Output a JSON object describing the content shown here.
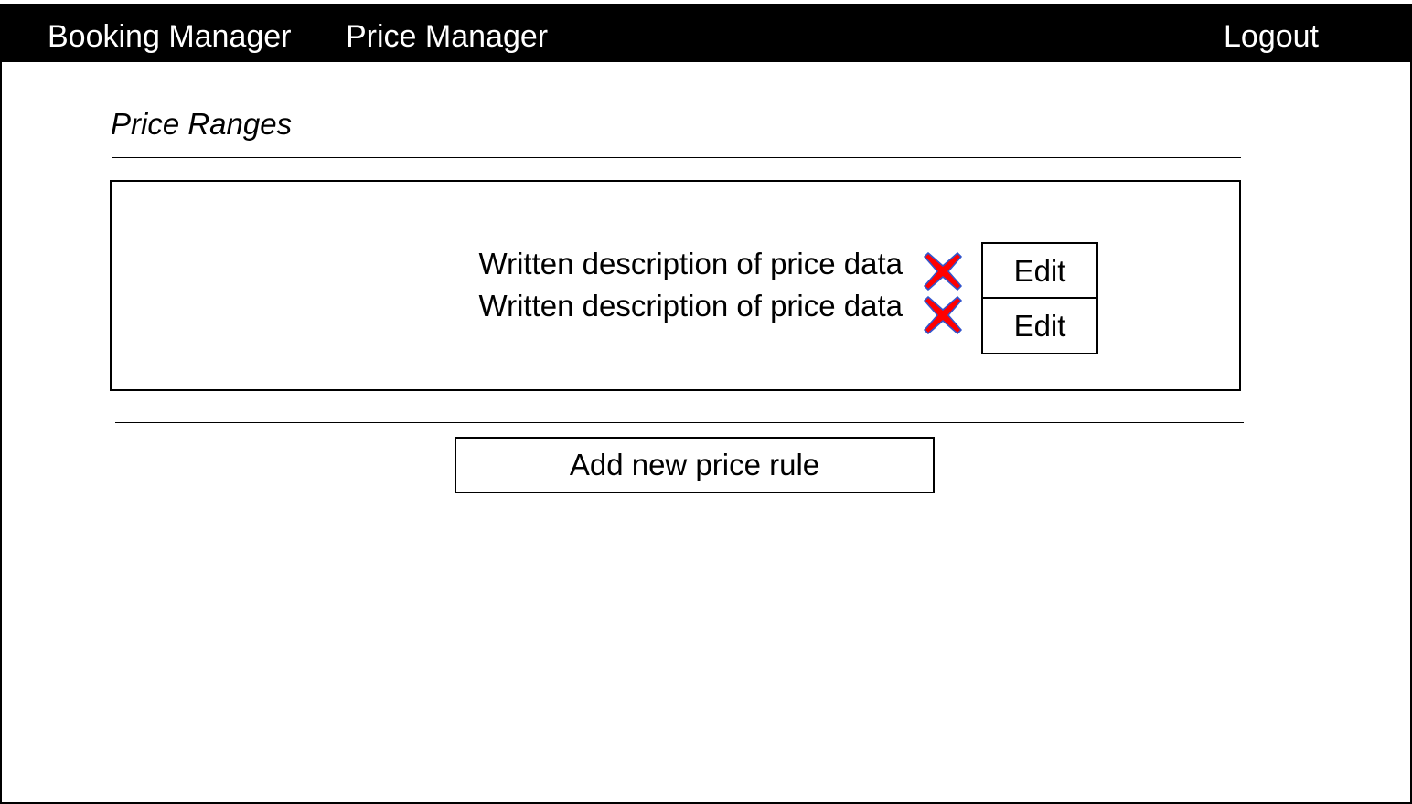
{
  "nav": {
    "booking_manager": "Booking Manager",
    "price_manager": "Price Manager",
    "logout": "Logout"
  },
  "section": {
    "title": "Price Ranges"
  },
  "price_rules": [
    {
      "description": "Written description of price data",
      "edit_label": "Edit",
      "delete_icon": "red-x-icon"
    },
    {
      "description": "Written description of price data",
      "edit_label": "Edit",
      "delete_icon": "red-x-icon"
    }
  ],
  "actions": {
    "add_rule_label": "Add new price rule"
  },
  "colors": {
    "navbar_bg": "#000000",
    "navbar_text": "#ffffff",
    "delete_icon_fill": "#ff0000",
    "delete_icon_outline": "#3355cc"
  }
}
